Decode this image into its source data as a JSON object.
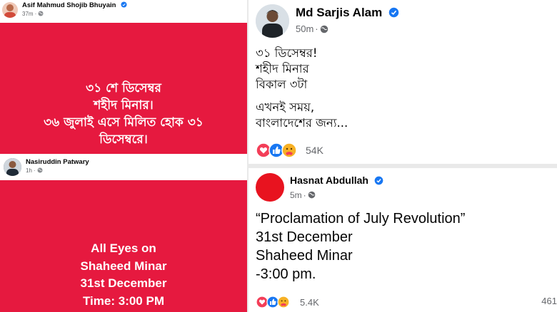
{
  "post_a": {
    "author": "Asif Mahmud Shojib Bhuyain",
    "time": "37m",
    "dot": "·",
    "image_text": [
      "৩১ শে ডিসেম্বর",
      "শহীদ মিনার।",
      "৩৬ জুলাই এসে মিলিত হোক ৩১",
      "ডিসেম্বরে।"
    ]
  },
  "post_b": {
    "author": "Nasiruddin Patwary",
    "time": "1h",
    "dot": "·",
    "image_text": [
      "All Eyes on",
      "Shaheed Minar",
      "31st December",
      "Time: 3:00 PM"
    ]
  },
  "post_c": {
    "author": "Md Sarjis Alam",
    "time": "50m",
    "dot": "·",
    "lines": [
      "৩১ ডিসেম্বর!",
      "শহীদ মিনার",
      "বিকাল ৩টা"
    ],
    "lines2": [
      "এখনই সময়,",
      "বাংলাদেশের জন্য..."
    ],
    "reaction_count": "54K",
    "reactions": [
      "love",
      "like",
      "care"
    ]
  },
  "post_d": {
    "author": "Hasnat Abdullah",
    "time": "5m",
    "dot": "·",
    "lines": [
      "“Proclamation of July Revolution”",
      "31st December",
      "Shaheed Minar",
      "-3:00 pm."
    ],
    "reaction_count": "5.4K",
    "side_count": "461",
    "reactions": [
      "love",
      "like",
      "care"
    ]
  },
  "colors": {
    "card_red": "#e6193f",
    "verified_blue": "#1877f2",
    "meta_gray": "#65676b"
  }
}
